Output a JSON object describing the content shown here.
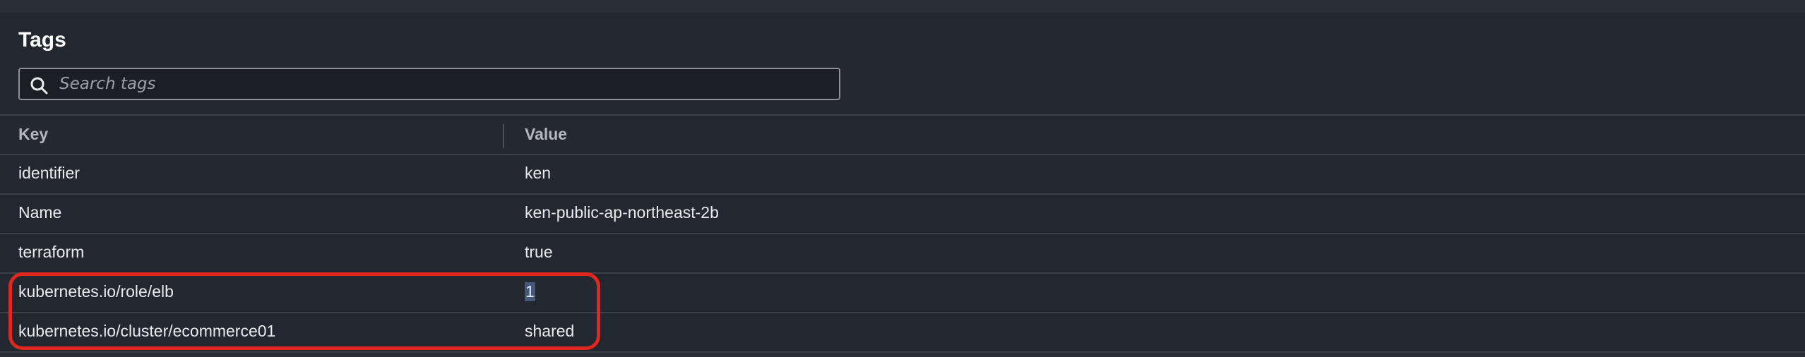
{
  "tags_panel": {
    "title": "Tags",
    "search": {
      "placeholder": "Search tags",
      "value": ""
    },
    "table": {
      "columns": [
        "Key",
        "Value"
      ],
      "rows": [
        {
          "key": "identifier",
          "value": "ken"
        },
        {
          "key": "Name",
          "value": "ken-public-ap-northeast-2b"
        },
        {
          "key": "terraform",
          "value": "true"
        },
        {
          "key": "kubernetes.io/role/elb",
          "value": "1"
        },
        {
          "key": "kubernetes.io/cluster/ecommerce01",
          "value": "shared"
        }
      ]
    }
  },
  "colors": {
    "page_background": "#2a2e35",
    "panel_background": "#232730",
    "annotation_outline": "#e0281f",
    "selection_highlight": "#44597a"
  },
  "icons": {
    "search": "search-icon"
  }
}
